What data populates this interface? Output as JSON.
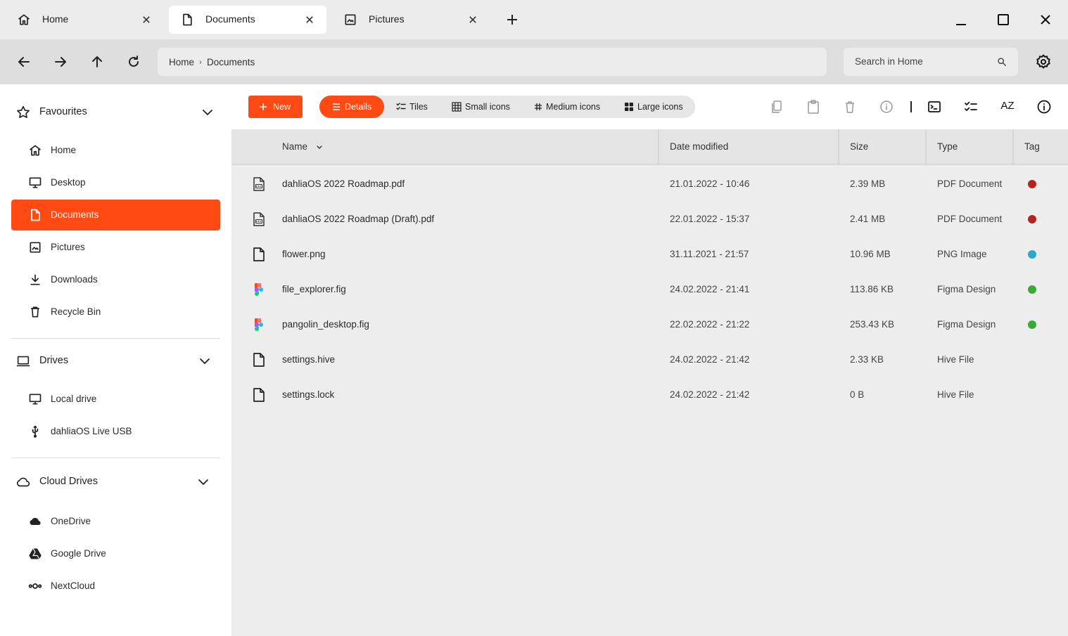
{
  "tabs": [
    {
      "label": "Home",
      "icon": "home-icon"
    },
    {
      "label": "Documents",
      "icon": "document-icon"
    },
    {
      "label": "Pictures",
      "icon": "image-icon"
    }
  ],
  "active_tab": "Documents",
  "breadcrumb": {
    "items": [
      "Home",
      "Documents"
    ],
    "separator": "›"
  },
  "search": {
    "placeholder": "Search in Home"
  },
  "sidebar": {
    "favourites": {
      "title": "Favourites",
      "items": [
        {
          "label": "Home",
          "icon": "home-icon"
        },
        {
          "label": "Desktop",
          "icon": "monitor-icon"
        },
        {
          "label": "Documents",
          "icon": "document-icon",
          "active": true
        },
        {
          "label": "Pictures",
          "icon": "image-icon"
        },
        {
          "label": "Downloads",
          "icon": "download-icon"
        },
        {
          "label": "Recycle Bin",
          "icon": "trash-icon"
        }
      ]
    },
    "drives": {
      "title": "Drives",
      "items": [
        {
          "label": "Local drive",
          "icon": "monitor-icon"
        },
        {
          "label": "dahliaOS Live USB",
          "icon": "usb-icon"
        }
      ]
    },
    "cloud": {
      "title": "Cloud Drives",
      "items": [
        {
          "label": "OneDrive",
          "icon": "cloud-filled-icon"
        },
        {
          "label": "Google Drive",
          "icon": "google-drive-icon"
        },
        {
          "label": "NextCloud",
          "icon": "nextcloud-icon"
        }
      ]
    }
  },
  "toolbar": {
    "new_label": "New",
    "views": [
      {
        "label": "Details",
        "icon": "list-icon",
        "active": true
      },
      {
        "label": "Tiles",
        "icon": "checklist-icon"
      },
      {
        "label": "Small icons",
        "icon": "grid-small-icon"
      },
      {
        "label": "Medium icons",
        "icon": "grid-medium-icon"
      },
      {
        "label": "Large icons",
        "icon": "grid-large-icon"
      }
    ],
    "actions": [
      "copy-icon",
      "paste-icon",
      "delete-icon",
      "properties-icon",
      "terminal-icon",
      "select-icon",
      "sort-az-icon",
      "info-icon"
    ],
    "sort_label": "AZ"
  },
  "columns": [
    "Name",
    "Date modified",
    "Size",
    "Type",
    "Tag"
  ],
  "files": [
    {
      "name": "dahliaOS 2022 Roadmap.pdf",
      "date": "21.01.2022 -  10:46",
      "size": "2.39 MB",
      "type": "PDF Document",
      "tag": "#b3261e",
      "icon": "pdf-icon"
    },
    {
      "name": "dahliaOS 2022 Roadmap (Draft).pdf",
      "date": "22.01.2022 -  15:37",
      "size": "2.41 MB",
      "type": "PDF Document",
      "tag": "#b3261e",
      "icon": "pdf-icon"
    },
    {
      "name": "flower.png",
      "date": "31.11.2021 -  21:57",
      "size": "10.96 MB",
      "type": "PNG Image",
      "tag": "#2ea7c9",
      "icon": "file-icon"
    },
    {
      "name": "file_explorer.fig",
      "date": "24.02.2022 -  21:41",
      "size": "113.86 KB",
      "type": "Figma Design",
      "tag": "#3aa935",
      "icon": "figma-icon"
    },
    {
      "name": "pangolin_desktop.fig",
      "date": "22.02.2022 -  21:22",
      "size": "253.43 KB",
      "type": "Figma Design",
      "tag": "#3aa935",
      "icon": "figma-icon"
    },
    {
      "name": "settings.hive",
      "date": "24.02.2022 -  21:42",
      "size": "2.33 KB",
      "type": "Hive File",
      "tag": "",
      "icon": "file-icon"
    },
    {
      "name": "settings.lock",
      "date": "24.02.2022 -  21:42",
      "size": "0 B",
      "type": "Hive File",
      "tag": "",
      "icon": "file-icon"
    }
  ],
  "colors": {
    "accent": "#ff4a13",
    "tabbar": "#ececec",
    "navbar": "#dedede",
    "filepane": "#ededed"
  }
}
